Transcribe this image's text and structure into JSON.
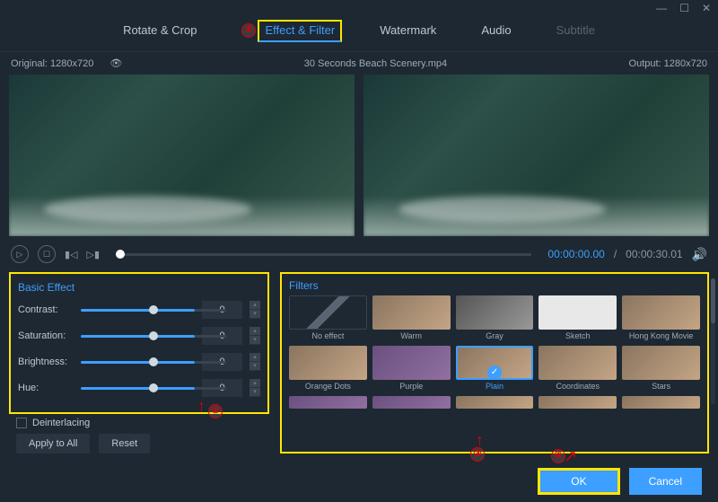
{
  "window": {
    "min": "—",
    "max": "☐",
    "close": "✕"
  },
  "tabs": {
    "rotate": "Rotate & Crop",
    "effect": "Effect & Filter",
    "watermark": "Watermark",
    "audio": "Audio",
    "subtitle": "Subtitle"
  },
  "preview": {
    "original_label": "Original: 1280x720",
    "filename": "30 Seconds Beach Scenery.mp4",
    "output_label": "Output: 1280x720"
  },
  "playback": {
    "current": "00:00:00.00",
    "sep": "/",
    "total": "00:00:30.01"
  },
  "basic": {
    "title": "Basic Effect",
    "contrast": {
      "label": "Contrast:",
      "value": "0"
    },
    "saturation": {
      "label": "Saturation:",
      "value": "0"
    },
    "brightness": {
      "label": "Brightness:",
      "value": "0"
    },
    "hue": {
      "label": "Hue:",
      "value": "0"
    },
    "deinterlacing": "Deinterlacing",
    "apply_all": "Apply to All",
    "reset": "Reset"
  },
  "filters": {
    "title": "Filters",
    "items": [
      {
        "name": "No effect"
      },
      {
        "name": "Warm"
      },
      {
        "name": "Gray"
      },
      {
        "name": "Sketch"
      },
      {
        "name": "Hong Kong Movie"
      },
      {
        "name": "Orange Dots"
      },
      {
        "name": "Purple"
      },
      {
        "name": "Plain",
        "selected": true
      },
      {
        "name": "Coordinates"
      },
      {
        "name": "Stars"
      }
    ]
  },
  "footer": {
    "ok": "OK",
    "cancel": "Cancel"
  },
  "annotations": {
    "n1": "①",
    "n2": "②",
    "n3": "③",
    "n4": "④"
  }
}
